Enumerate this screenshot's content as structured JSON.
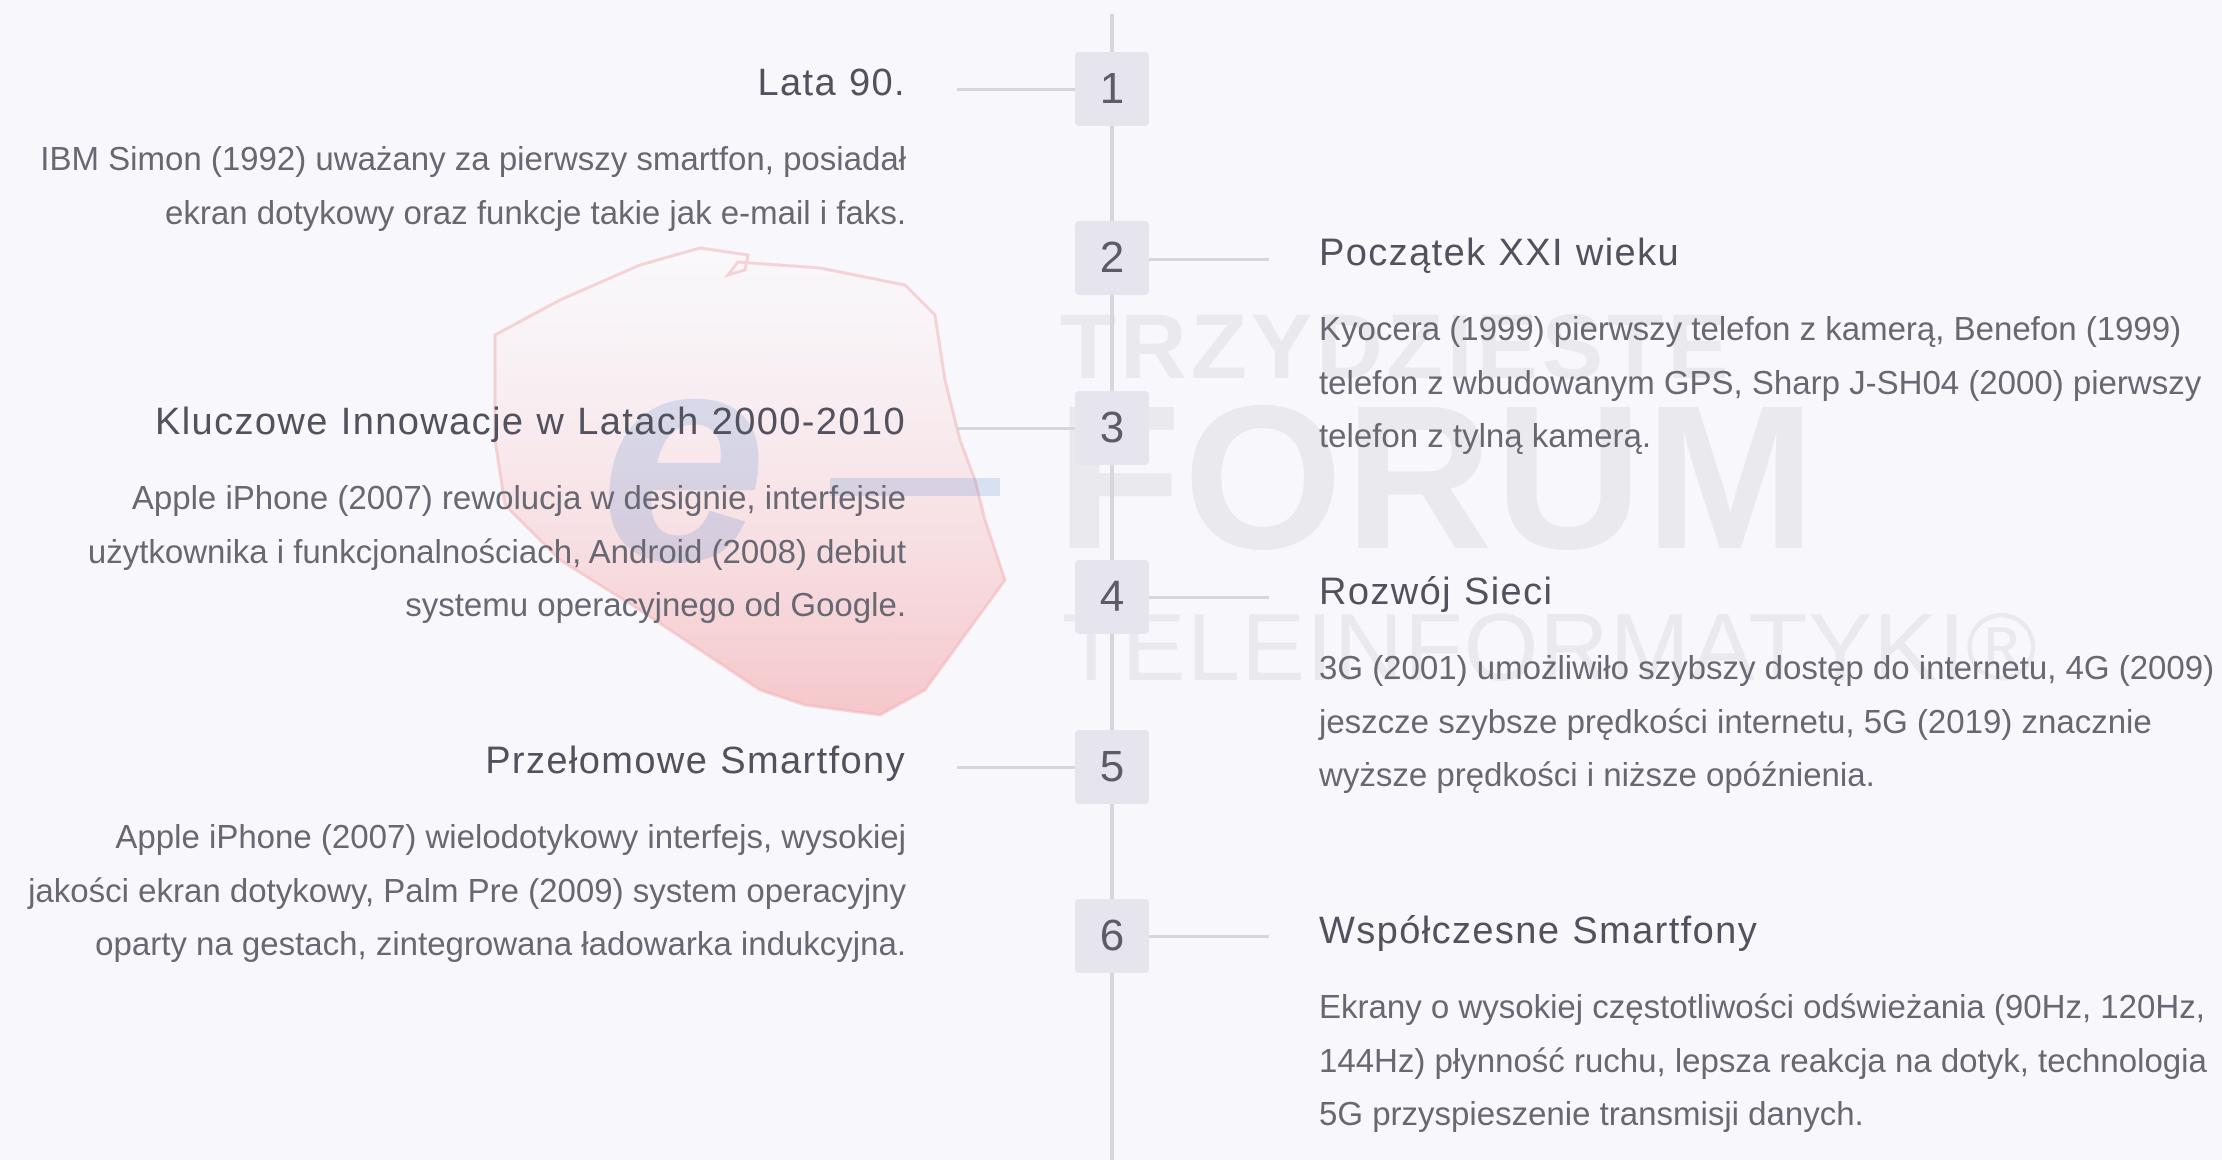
{
  "timeline": {
    "items": [
      {
        "number": "1",
        "title": "Lata 90.",
        "desc": "IBM Simon (1992) uważany za pierwszy smartfon, posiadał ekran dotykowy oraz funkcje takie jak e-mail i faks."
      },
      {
        "number": "2",
        "title": "Początek XXI wieku",
        "desc": "Kyocera (1999) pierwszy telefon z kamerą, Benefon (1999) telefon z wbudowanym GPS, Sharp J-SH04 (2000) pierwszy telefon z tylną kamerą."
      },
      {
        "number": "3",
        "title": "Kluczowe Innowacje w Latach 2000-2010",
        "desc": "Apple iPhone (2007) rewolucja w designie, interfejsie użytkownika i funkcjonalnościach, Android (2008) debiut systemu operacyjnego od Google."
      },
      {
        "number": "4",
        "title": "Rozwój Sieci",
        "desc": "3G (2001) umożliwiło szybszy dostęp do internetu, 4G (2009) jeszcze szybsze prędkości internetu, 5G (2019) znacznie wyższe prędkości i niższe opóźnienia."
      },
      {
        "number": "5",
        "title": "Przełomowe Smartfony",
        "desc": "Apple iPhone (2007) wielodotykowy interfejs, wysokiej jakości ekran dotykowy, Palm Pre (2009) system operacyjny oparty na gestach, zintegrowana ładowarka indukcyjna."
      },
      {
        "number": "6",
        "title": "Współczesne Smartfony",
        "desc": "Ekrany o wysokiej częstotliwości odświeżania (90Hz, 120Hz, 144Hz) płynność ruchu, lepsza reakcja na dotyk, technologia 5G przyspieszenie transmisji danych."
      }
    ]
  },
  "watermark": {
    "line1": "TRZYDZIESTE",
    "line2": "FORUM",
    "line3": "TELEINFORMATYKI®",
    "logo_letter": "e"
  },
  "colors": {
    "background": "#f8f7fb",
    "badge": "#e6e5ee",
    "line": "#d6d6de",
    "watermark_red": "#e8343a",
    "watermark_blue": "#2a73c4"
  }
}
